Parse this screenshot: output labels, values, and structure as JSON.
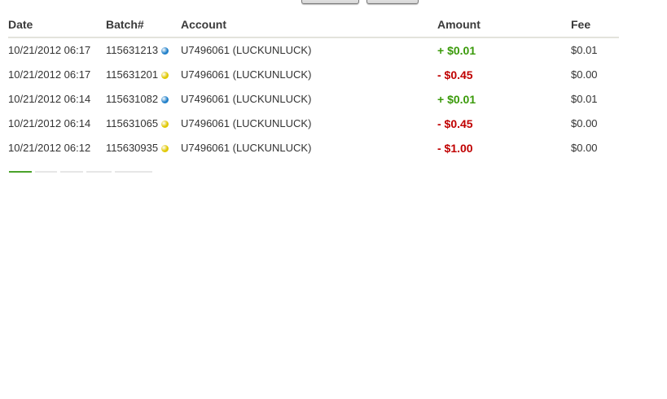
{
  "colors": {
    "positive_amount": "#3a9a0a",
    "negative_amount": "#c00000",
    "header_rule": "#e3e3dc",
    "pager_active": "#4aa32a",
    "pager_inactive": "#e6e6e6"
  },
  "table": {
    "headers": {
      "date": "Date",
      "batch": "Batch#",
      "account": "Account",
      "amount": "Amount",
      "fee": "Fee"
    },
    "rows": [
      {
        "date": "10/21/2012 06:17",
        "batch": "115631213",
        "status_color": "#1f7fc9",
        "status_icon": "blue-dot-icon",
        "account": "U7496061 (LUCKUNLUCK)",
        "amount": "+ $0.01",
        "amount_type": "positive",
        "fee": "$0.01"
      },
      {
        "date": "10/21/2012 06:17",
        "batch": "115631201",
        "status_color": "#e0c800",
        "status_icon": "yellow-dot-icon",
        "account": "U7496061 (LUCKUNLUCK)",
        "amount": "- $0.45",
        "amount_type": "negative",
        "fee": "$0.00"
      },
      {
        "date": "10/21/2012 06:14",
        "batch": "115631082",
        "status_color": "#1f7fc9",
        "status_icon": "blue-dot-icon",
        "account": "U7496061 (LUCKUNLUCK)",
        "amount": "+ $0.01",
        "amount_type": "positive",
        "fee": "$0.01"
      },
      {
        "date": "10/21/2012 06:14",
        "batch": "115631065",
        "status_color": "#e0c800",
        "status_icon": "yellow-dot-icon",
        "account": "U7496061 (LUCKUNLUCK)",
        "amount": "- $0.45",
        "amount_type": "negative",
        "fee": "$0.00"
      },
      {
        "date": "10/21/2012 06:12",
        "batch": "115630935",
        "status_color": "#e0c800",
        "status_icon": "yellow-dot-icon",
        "account": "U7496061 (LUCKUNLUCK)",
        "amount": "- $1.00",
        "amount_type": "negative",
        "fee": "$0.00"
      }
    ]
  },
  "pager": {
    "page_count": 5,
    "active_index": 0
  }
}
